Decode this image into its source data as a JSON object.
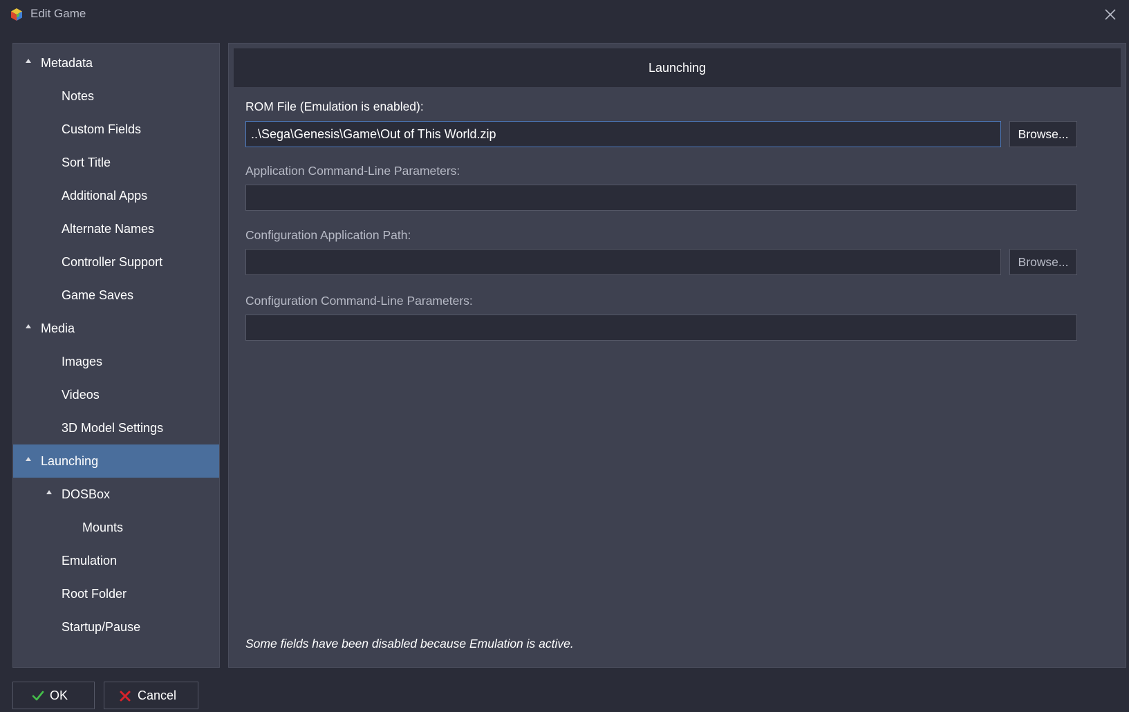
{
  "window": {
    "title": "Edit Game",
    "app_icon": "app-cube-icon",
    "close_icon": "close-icon"
  },
  "sidebar": {
    "items": [
      {
        "label": "Metadata",
        "level": 0,
        "expanded": true,
        "selected": false
      },
      {
        "label": "Notes",
        "level": 1,
        "expanded": false,
        "selected": false
      },
      {
        "label": "Custom Fields",
        "level": 1,
        "expanded": false,
        "selected": false
      },
      {
        "label": "Sort Title",
        "level": 1,
        "expanded": false,
        "selected": false
      },
      {
        "label": "Additional Apps",
        "level": 1,
        "expanded": false,
        "selected": false
      },
      {
        "label": "Alternate Names",
        "level": 1,
        "expanded": false,
        "selected": false
      },
      {
        "label": "Controller Support",
        "level": 1,
        "expanded": false,
        "selected": false
      },
      {
        "label": "Game Saves",
        "level": 1,
        "expanded": false,
        "selected": false
      },
      {
        "label": "Media",
        "level": 0,
        "expanded": true,
        "selected": false
      },
      {
        "label": "Images",
        "level": 1,
        "expanded": false,
        "selected": false
      },
      {
        "label": "Videos",
        "level": 1,
        "expanded": false,
        "selected": false
      },
      {
        "label": "3D Model Settings",
        "level": 1,
        "expanded": false,
        "selected": false
      },
      {
        "label": "Launching",
        "level": 0,
        "expanded": true,
        "selected": true
      },
      {
        "label": "DOSBox",
        "level": 1,
        "expanded": true,
        "selected": false
      },
      {
        "label": "Mounts",
        "level": 2,
        "expanded": false,
        "selected": false
      },
      {
        "label": "Emulation",
        "level": 1,
        "expanded": false,
        "selected": false
      },
      {
        "label": "Root Folder",
        "level": 1,
        "expanded": false,
        "selected": false
      },
      {
        "label": "Startup/Pause",
        "level": 1,
        "expanded": false,
        "selected": false
      }
    ]
  },
  "main": {
    "header": "Launching",
    "rom_file": {
      "label": "ROM File (Emulation is enabled):",
      "value": "..\\Sega\\Genesis\\Game\\Out of This World.zip",
      "browse_label": "Browse..."
    },
    "app_params": {
      "label": "Application Command-Line Parameters:",
      "value": ""
    },
    "config_path": {
      "label": "Configuration Application Path:",
      "value": "",
      "browse_label": "Browse..."
    },
    "config_params": {
      "label": "Configuration Command-Line Parameters:",
      "value": ""
    },
    "note": "Some fields have been disabled because Emulation is active."
  },
  "footer": {
    "ok_label": "OK",
    "ok_icon": "checkmark-icon",
    "cancel_label": "Cancel",
    "cancel_icon": "cross-icon"
  },
  "colors": {
    "background": "#2a2c38",
    "panel": "#3e4150",
    "selected": "#4a6e9c",
    "focus_border": "#4f7cc0",
    "ok_green": "#45c04a",
    "cancel_red": "#d8232a"
  }
}
